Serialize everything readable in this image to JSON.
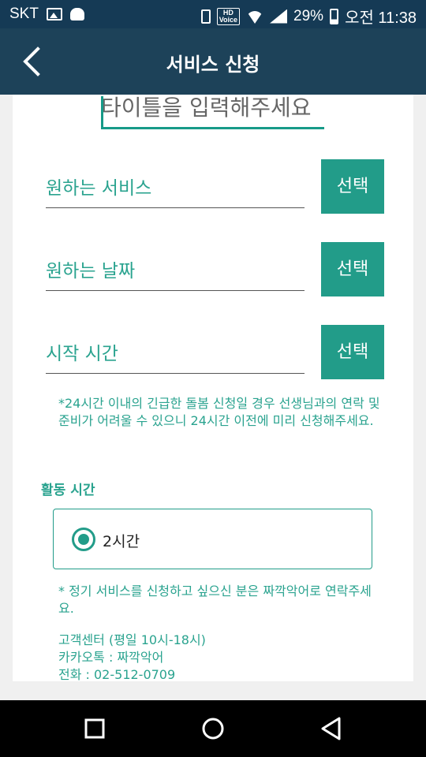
{
  "status_bar": {
    "carrier": "SKT",
    "hd_label_top": "HD",
    "hd_label_bottom": "Voice",
    "battery": "29%",
    "time": "오전 11:38"
  },
  "app_bar": {
    "title": "서비스 신청",
    "back_icon": "back-arrow-icon"
  },
  "form": {
    "title_input": "타이틀을 입력해주세요",
    "fields": [
      {
        "label": "원하는 서비스",
        "button": "선택"
      },
      {
        "label": "원하는 날짜",
        "button": "선택"
      },
      {
        "label": "시작 시간",
        "button": "선택"
      }
    ],
    "notice": "*24시간 이내의 긴급한 돌봄 신청일 경우 선생님과의 연락 및 준비가 어려울 수 있으니 24시간 이전에 미리 신청해주세요.",
    "activity_label": "활동 시간",
    "activity_option": "2시간",
    "notice2": "* 정기 서비스를 신청하고 싶으신 분은 짜깍악어로 연락주세요.",
    "contact": {
      "line1": "고객센터 (평일 10시-18시)",
      "line2": "카카오톡 : 짜깍악어",
      "line3": "전화 : 02-512-0709"
    }
  },
  "colors": {
    "status_bar": "#153a55",
    "app_bar": "#1d4259",
    "accent": "#229c89",
    "text_accent": "#2aa38f"
  },
  "nav_bar": {
    "icons": [
      "recents-icon",
      "home-icon",
      "back-icon"
    ]
  }
}
